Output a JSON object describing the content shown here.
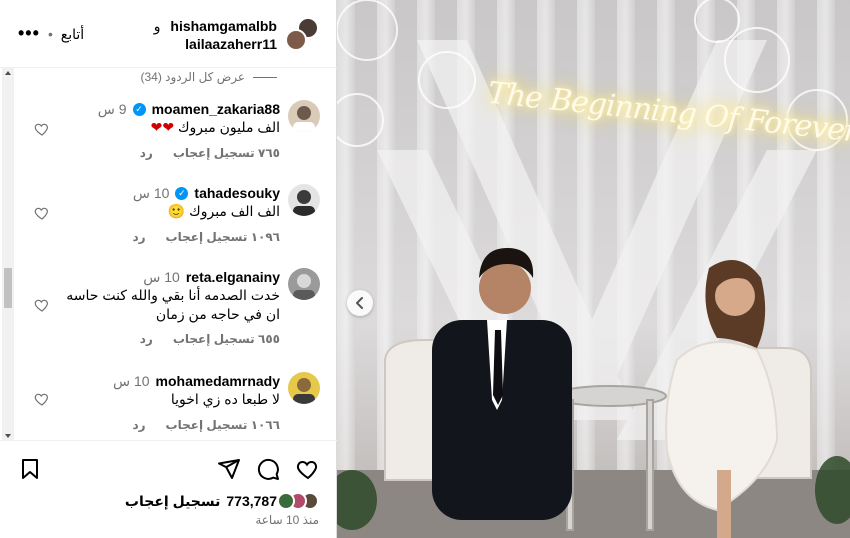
{
  "header": {
    "user1": "hishamgamalbb",
    "and_word": "و",
    "user2": "lailaazaherr11",
    "follow_label": "أتابع",
    "dot": "•",
    "more_label": "•••"
  },
  "comments_section": {
    "view_replies": "عرض كل الردود (34)"
  },
  "comments": [
    {
      "username": "moamen_zakaria88",
      "verified": true,
      "time": "9 س",
      "text": "الف مليون مبروك ❤❤",
      "likes": "٧٦٥ تسجيل إعجاب",
      "reply": "رد",
      "avatar_color": "#6d5a4c"
    },
    {
      "username": "tahadesouky",
      "verified": true,
      "time": "10 س",
      "text": "الف الف مبروك 🙂",
      "likes": "١٠٩٦ تسجيل إعجاب",
      "reply": "رد",
      "avatar_color": "#3b3b3b"
    },
    {
      "username": "reta.elganainy",
      "verified": false,
      "time": "10 س",
      "text": "خدت الصدمه أنا بقي والله كنت حاسه ان في حاجه من زمان",
      "likes": "٦٥٥ تسجيل إعجاب",
      "reply": "رد",
      "avatar_color": "#7a7a7a"
    },
    {
      "username": "mohamedamrnady",
      "verified": false,
      "time": "10 س",
      "text": "لا طبعا ده زي اخويا",
      "likes": "١٠٦٦ تسجيل إعجاب",
      "reply": "رد",
      "avatar_color": "#8a6a3a"
    }
  ],
  "actions": {
    "likes_count": "773,787",
    "likes_label": "تسجيل إعجاب",
    "time_ago": "منذ 10 ساعة",
    "like_avatar_colors": [
      "#3a6b3a",
      "#b24a6a",
      "#5a4a3a"
    ]
  },
  "photo": {
    "neon_text": "The Beginning Of Forever"
  },
  "colors": {
    "verified_badge": "#0095f6",
    "secondary_text": "#737373",
    "heart_red": "#d10000"
  },
  "icons": {
    "more": "more-options-icon",
    "save": "bookmark-icon",
    "share": "share-icon",
    "comment": "comment-icon",
    "like": "heart-icon",
    "comment_like": "heart-outline-icon",
    "verified": "verified-badge-icon",
    "carousel_prev": "chevron-left-icon"
  }
}
